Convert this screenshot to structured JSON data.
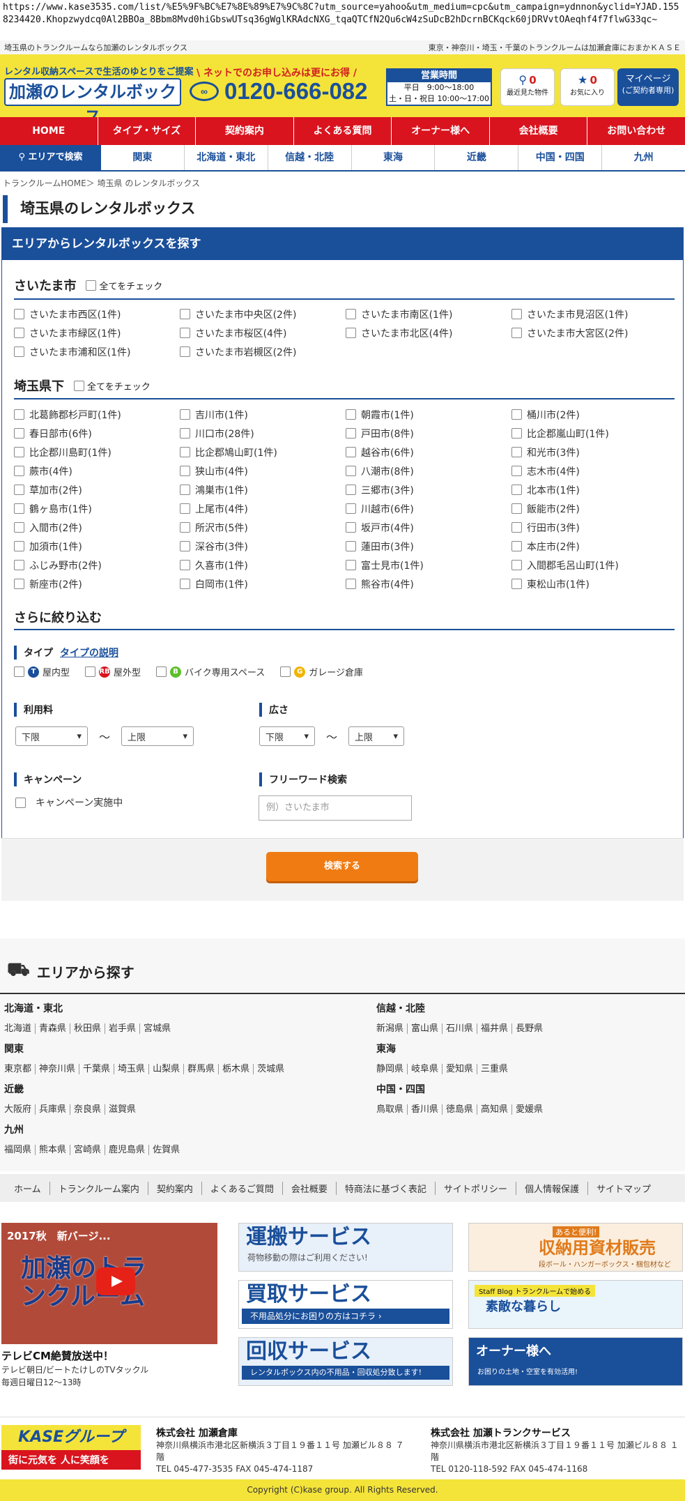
{
  "url": "https://www.kase3535.com/list/%E5%9F%BC%E7%8E%89%E7%9C%8C?utm_source=yahoo&utm_medium=cpc&utm_campaign=ydnnon&yclid=YJAD.1558234420.Khopzwydcq0Al2BBOa_8Bbm8Mvd0hiGbswUTsq36gWglKRAdcNXG_tqaQTCfN2Qu6cW4zSuDcB2hDcrnBCKqck60jDRVvtOAeqhf4f7flwG33qc~",
  "topbar": {
    "left": "埼玉県のトランクルームなら加瀬のレンタルボックス",
    "right": "東京・神奈川・埼玉・千葉のトランクルームは加瀬倉庫におまかＫＡＳＥ"
  },
  "header": {
    "tagline": "レンタル収納スペースで生活のゆとりをご提案",
    "logo": "加瀬のレンタルボックス",
    "net_msg": "\\ ネットでのお申し込みは更にお得 /",
    "phone": "0120-666-082",
    "hours_title": "営業時間",
    "hours_weekday": "平日　9:00～18:00",
    "hours_weekend": "土・日・祝日 10:00～17:00",
    "recent_count": "0",
    "recent_label": "最近見た物件",
    "fav_count": "0",
    "fav_label": "お気に入り",
    "mypage": "マイページ",
    "mypage_sub": "(ご契約者専用)"
  },
  "nav": [
    "HOME",
    "タイプ・サイズ",
    "契約案内",
    "よくある質問",
    "オーナー様へ",
    "会社概要",
    "お問い合わせ"
  ],
  "area_nav": {
    "search": "エリアで検索",
    "items": [
      "関東",
      "北海道・東北",
      "信越・北陸",
      "東海",
      "近畿",
      "中国・四国",
      "九州"
    ]
  },
  "breadcrumb": "トランクルームHOME＞ 埼玉県 のレンタルボックス",
  "page_title": "埼玉県のレンタルボックス",
  "panel_title": "エリアからレンタルボックスを探す",
  "check_all": "全てをチェック",
  "saitama": {
    "title": "さいたま市",
    "items": [
      "さいたま市西区(1件)",
      "さいたま市中央区(2件)",
      "さいたま市南区(1件)",
      "さいたま市見沼区(1件)",
      "さいたま市緑区(1件)",
      "さいたま市桜区(4件)",
      "さいたま市北区(4件)",
      "さいたま市大宮区(2件)",
      "さいたま市浦和区(1件)",
      "さいたま市岩槻区(2件)"
    ]
  },
  "saitama_ken": {
    "title": "埼玉県下",
    "items": [
      "北葛飾郡杉戸町(1件)",
      "吉川市(1件)",
      "朝霞市(1件)",
      "桶川市(2件)",
      "春日部市(6件)",
      "川口市(28件)",
      "戸田市(8件)",
      "比企郡嵐山町(1件)",
      "比企郡川島町(1件)",
      "比企郡鳩山町(1件)",
      "越谷市(6件)",
      "和光市(3件)",
      "蕨市(4件)",
      "狭山市(4件)",
      "八潮市(8件)",
      "志木市(4件)",
      "草加市(2件)",
      "鴻巣市(1件)",
      "三郷市(3件)",
      "北本市(1件)",
      "鶴ヶ島市(1件)",
      "上尾市(4件)",
      "川越市(6件)",
      "飯能市(2件)",
      "入間市(2件)",
      "所沢市(5件)",
      "坂戸市(4件)",
      "行田市(3件)",
      "加須市(1件)",
      "深谷市(3件)",
      "蓮田市(3件)",
      "本庄市(2件)",
      "ふじみ野市(2件)",
      "久喜市(1件)",
      "富士見市(1件)",
      "入間郡毛呂山町(1件)",
      "新座市(2件)",
      "白岡市(1件)",
      "熊谷市(4件)",
      "東松山市(1件)"
    ]
  },
  "refine": {
    "title": "さらに絞り込む",
    "type_label": "タイプ",
    "type_link": "タイプの説明",
    "types": [
      {
        "icon": "T",
        "color": "#1a4f9a",
        "label": "屋内型"
      },
      {
        "icon": "RB",
        "color": "#d9141e",
        "label": "屋外型"
      },
      {
        "icon": "B",
        "color": "#5cbf2a",
        "label": "バイク専用スペース"
      },
      {
        "icon": "G",
        "color": "#f0b400",
        "label": "ガレージ倉庫"
      }
    ],
    "fee_label": "利用料",
    "size_label": "広さ",
    "lower": "下限",
    "upper": "上限",
    "tilde": "～",
    "campaign_label": "キャンペーン",
    "campaign_item": "キャンペーン実施中",
    "freeword_label": "フリーワード検索",
    "freeword_placeholder": "例）さいたま市",
    "search_button": "検索する"
  },
  "area2": {
    "title": "エリアから探す",
    "regions": [
      {
        "name": "北海道・東北",
        "prefs": [
          "北海道",
          "青森県",
          "秋田県",
          "岩手県",
          "宮城県"
        ]
      },
      {
        "name": "信越・北陸",
        "prefs": [
          "新潟県",
          "富山県",
          "石川県",
          "福井県",
          "長野県"
        ]
      },
      {
        "name": "関東",
        "prefs": [
          "東京都",
          "神奈川県",
          "千葉県",
          "埼玉県",
          "山梨県",
          "群馬県",
          "栃木県",
          "茨城県"
        ]
      },
      {
        "name": "東海",
        "prefs": [
          "静岡県",
          "岐阜県",
          "愛知県",
          "三重県"
        ]
      },
      {
        "name": "近畿",
        "prefs": [
          "大阪府",
          "兵庫県",
          "奈良県",
          "滋賀県"
        ]
      },
      {
        "name": "中国・四国",
        "prefs": [
          "鳥取県",
          "香川県",
          "徳島県",
          "高知県",
          "愛媛県"
        ]
      },
      {
        "name": "九州",
        "prefs": [
          "福岡県",
          "熊本県",
          "宮崎県",
          "鹿児島県",
          "佐賀県"
        ]
      }
    ]
  },
  "footnav": [
    "ホーム",
    "トランクルーム案内",
    "契約案内",
    "よくあるご質問",
    "会社概要",
    "特商法に基づく表記",
    "サイトポリシー",
    "個人情報保護",
    "サイトマップ"
  ],
  "video": {
    "title": "2017秋　新バージ...",
    "big": "加瀬のトランクルーム",
    "caption": "テレビCM絶賛放送中！",
    "sub1": "テレビ朝日/ビートたけしのTVタックル",
    "sub2": "毎週日曜日12～13時"
  },
  "banners": [
    {
      "title": "運搬サービス",
      "sub": "荷物移動の際はご利用ください!"
    },
    {
      "title": "買取サービス",
      "sub": "不用品処分にお困りの方はコチラ ›"
    },
    {
      "title": "回収サービス",
      "sub": "レンタルボックス内の不用品・回収処分致します!"
    },
    {
      "title": "収納用資材販売",
      "sub": "段ボール・ハンガーボックス・梱包材など"
    },
    {
      "title": "素敵な暮らし",
      "sub": "Staff Blog トランクルームで始める"
    },
    {
      "title": "オーナー様へ",
      "sub": "お困りの土地・空室を有効活用!"
    }
  ],
  "banner_tag1": "あると便利!",
  "corp": {
    "logo": "KASEグループ",
    "slogan": "街に元気を 人に笑顔を",
    "c1_name": "株式会社 加瀬倉庫",
    "c1_addr": "神奈川県横浜市港北区新横浜３丁目１９番１１号 加瀬ビル８８ ７階",
    "c1_tel": "TEL 045-477-3535 FAX 045-474-1187",
    "c2_name": "株式会社 加瀬トランクサービス",
    "c2_addr": "神奈川県横浜市港北区新横浜３丁目１９番１１号 加瀬ビル８８ １階",
    "c2_tel": "TEL 0120-118-592 FAX 045-474-1168"
  },
  "copyright": "Copyright (C)kase group. All Rights Reserved."
}
